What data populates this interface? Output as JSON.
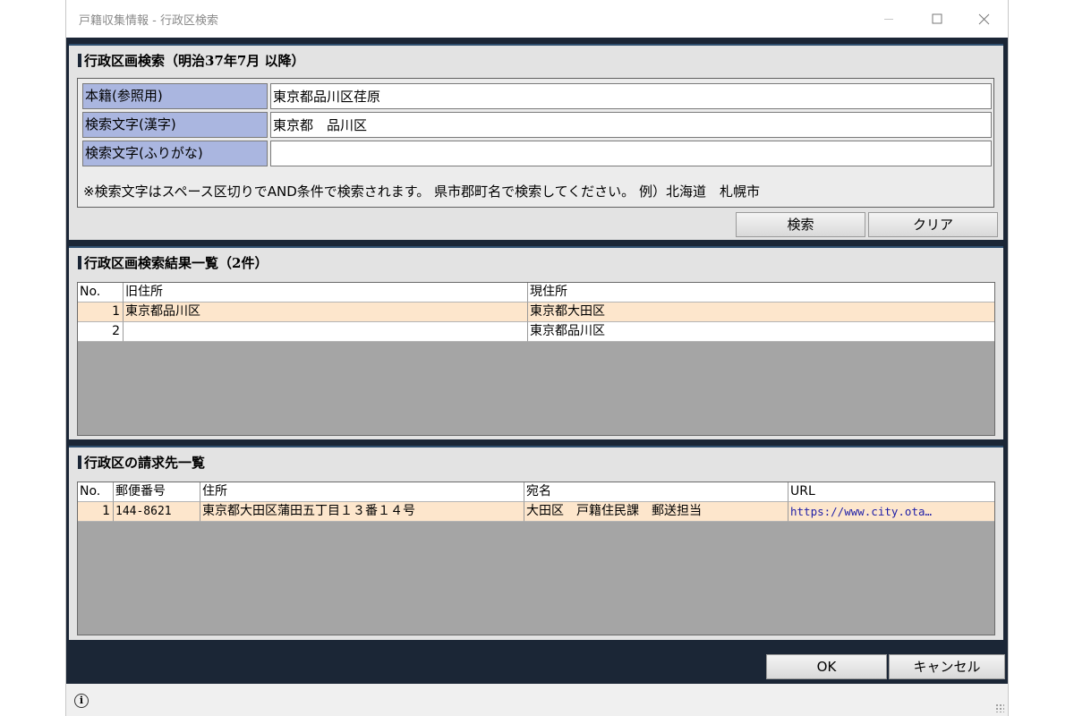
{
  "window": {
    "title": "戸籍収集情報 - 行政区検索"
  },
  "search": {
    "header": "行政区画検索（明治37年7月 以降）",
    "fields": [
      {
        "label": "本籍(参照用)",
        "value": "東京都品川区荏原"
      },
      {
        "label": "検索文字(漢字)",
        "value": "東京都　品川区"
      },
      {
        "label": "検索文字(ふりがな)",
        "value": ""
      }
    ],
    "hint": "※検索文字はスペース区切りでAND条件で検索されます。 県市郡町名で検索してください。 例）北海道　札幌市",
    "search_button": "検索",
    "clear_button": "クリア"
  },
  "results": {
    "header": "行政区画検索結果一覧（2件）",
    "columns": [
      "No.",
      "旧住所",
      "現住所"
    ],
    "rows": [
      {
        "no": "1",
        "old": "東京都品川区",
        "new": "東京都大田区"
      },
      {
        "no": "2",
        "old": "",
        "new": "東京都品川区"
      }
    ]
  },
  "offices": {
    "header": "行政区の請求先一覧",
    "columns": [
      "No.",
      "郵便番号",
      "住所",
      "宛名",
      "URL"
    ],
    "rows": [
      {
        "no": "1",
        "zip": "144-8621",
        "address": "東京都大田区蒲田五丁目１３番１４号",
        "recipient": "大田区　戸籍住民課　郵送担当",
        "url": "https://www.city.ota…"
      }
    ]
  },
  "footer": {
    "ok_button": "OK",
    "cancel_button": "キャンセル"
  },
  "icons": {
    "minimize": "minimize-icon",
    "maximize": "maximize-icon",
    "close": "close-icon",
    "info": "info-icon"
  }
}
